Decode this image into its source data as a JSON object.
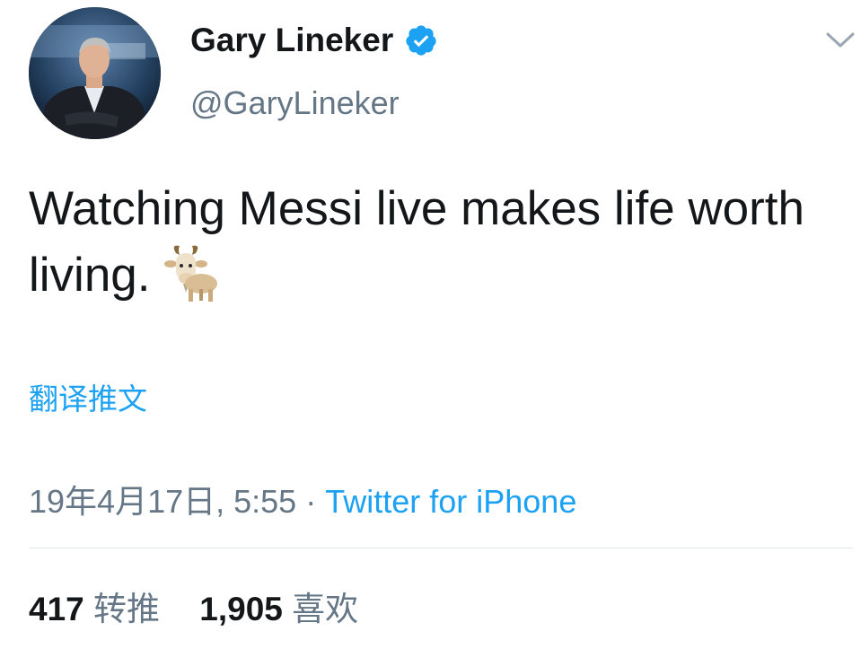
{
  "user": {
    "display_name": "Gary Lineker",
    "handle": "@GaryLineker",
    "verified": true
  },
  "tweet": {
    "text": "Watching Messi live makes life worth living.",
    "emoji": "goat-emoji"
  },
  "translate_label": "翻译推文",
  "meta": {
    "date": "19年4月17日, 5:55",
    "separator": "·",
    "source": "Twitter for iPhone"
  },
  "stats": {
    "retweets_count": "417",
    "retweets_label": "转推",
    "likes_count": "1,905",
    "likes_label": "喜欢"
  },
  "colors": {
    "link": "#1da1f2",
    "text": "#14171a",
    "secondary": "#657786",
    "divider": "#e1e8ed"
  },
  "icons": {
    "verified": "verified-badge-icon",
    "menu": "chevron-down-icon"
  }
}
